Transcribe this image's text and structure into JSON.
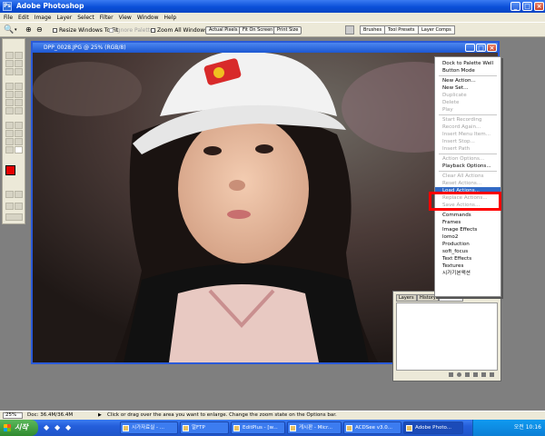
{
  "app": {
    "title": "Adobe Photoshop",
    "icon": "photoshop-icon"
  },
  "window_buttons": {
    "min": "_",
    "max": "□",
    "close": "×"
  },
  "menubar": [
    "File",
    "Edit",
    "Image",
    "Layer",
    "Select",
    "Filter",
    "View",
    "Window",
    "Help"
  ],
  "options": {
    "resize_windows": "Resize Windows To Fit",
    "ignore_palettes": "Ignore Palettes",
    "zoom_all": "Zoom All Windows",
    "actual_pixels": "Actual Pixels",
    "fit_on_screen": "Fit On Screen",
    "print_size": "Print Size"
  },
  "palette_well": [
    "Brushes",
    "Tool Presets",
    "Layer Comps"
  ],
  "document": {
    "title": "DPP_0028.JPG @ 25% (RGB/8)"
  },
  "actions_menu": [
    {
      "label": "Dock to Palette Well",
      "disabled": false
    },
    {
      "label": "Button Mode",
      "disabled": false
    },
    {
      "sep": true
    },
    {
      "label": "New Action...",
      "disabled": false
    },
    {
      "label": "New Set...",
      "disabled": false
    },
    {
      "label": "Duplicate",
      "disabled": true
    },
    {
      "label": "Delete",
      "disabled": true
    },
    {
      "label": "Play",
      "disabled": true
    },
    {
      "sep": true
    },
    {
      "label": "Start Recording",
      "disabled": true
    },
    {
      "label": "Record Again...",
      "disabled": true
    },
    {
      "label": "Insert Menu Item...",
      "disabled": true
    },
    {
      "label": "Insert Stop...",
      "disabled": true
    },
    {
      "label": "Insert Path",
      "disabled": true
    },
    {
      "sep": true
    },
    {
      "label": "Action Options...",
      "disabled": true
    },
    {
      "label": "Playback Options...",
      "disabled": false
    },
    {
      "sep": true
    },
    {
      "label": "Clear All Actions",
      "disabled": true
    },
    {
      "label": "Reset Actions...",
      "disabled": true
    },
    {
      "label": "Load Actions...",
      "disabled": false,
      "highlighted": true
    },
    {
      "label": "Replace Actions...",
      "disabled": true
    },
    {
      "label": "Save Actions...",
      "disabled": true
    },
    {
      "sep": true
    },
    {
      "label": "Commands",
      "disabled": false
    },
    {
      "label": "Frames",
      "disabled": false
    },
    {
      "label": "Image Effects",
      "disabled": false
    },
    {
      "label": "lomo2",
      "disabled": false
    },
    {
      "label": "Production",
      "disabled": false
    },
    {
      "label": "soft_focus",
      "disabled": false
    },
    {
      "label": "Text Effects",
      "disabled": false
    },
    {
      "label": "Textures",
      "disabled": false
    },
    {
      "label": "시가기본액션",
      "disabled": false
    }
  ],
  "layers_palette": {
    "tabs": [
      "Layers",
      "History",
      "Actions"
    ],
    "active_tab": "Actions"
  },
  "status": {
    "zoom": "25%",
    "doc": "Doc: 36.4M/36.4M",
    "hint": "Click or drag over the area you want to enlarge. Change the zoom state on the Options bar."
  },
  "taskbar": {
    "start_label": "시작",
    "tasks": [
      "시가자료실 - ...",
      "알FTP",
      "EditPlus - [w...",
      "게시판 - Micr...",
      "ACDSee v3.0...",
      "Adobe Photo..."
    ],
    "active_task": "Adobe Photo...",
    "clock": "오전 10:16"
  },
  "colors": {
    "title_blue": "#0a4fd8",
    "foreground": "#e60000",
    "background": "#ffffff",
    "highlight": "#316ac5",
    "annotation_red": "#ff0000"
  }
}
